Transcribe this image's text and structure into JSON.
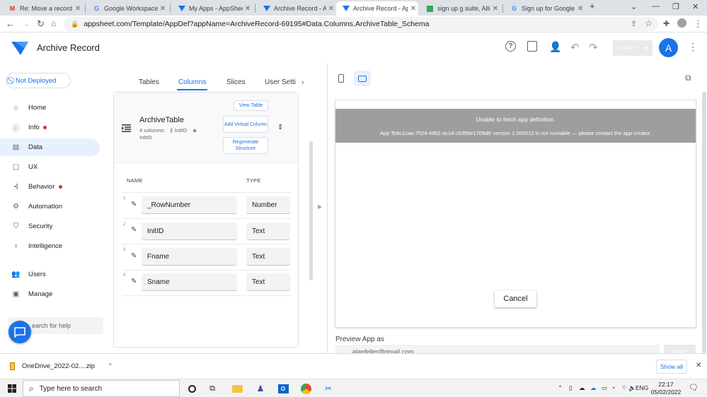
{
  "browser": {
    "tabs": [
      {
        "label": "Re: Move a record to",
        "icon": "gmail-icon"
      },
      {
        "label": "Google Workspace - (",
        "icon": "google-icon"
      },
      {
        "label": "My Apps - AppSheet",
        "icon": "appsheet-icon"
      },
      {
        "label": "Archive Record - App",
        "icon": "appsheet-icon"
      },
      {
        "label": "Archive Record - App",
        "icon": "appsheet-icon",
        "active": true
      },
      {
        "label": "sign up g suite, Allinfo",
        "icon": "sheets-icon"
      },
      {
        "label": "Sign up for Google W",
        "icon": "google-icon"
      }
    ],
    "new_tab": "+",
    "url": "appsheet.com/Template/AppDef?appName=ArchiveRecord-69195#Data.Columns.ArchiveTable_Schema"
  },
  "app": {
    "title": "Archive Record",
    "save_label": "SAVE",
    "avatar_letter": "A"
  },
  "sidebar": {
    "deploy_status": "Not Deployed",
    "items": [
      {
        "label": "Home",
        "icon": "home-icon"
      },
      {
        "label": "Info",
        "icon": "info-icon",
        "dot": true
      },
      {
        "label": "Data",
        "icon": "data-icon",
        "active": true
      },
      {
        "label": "UX",
        "icon": "ux-icon"
      },
      {
        "label": "Behavior",
        "icon": "behavior-icon",
        "dot": true
      },
      {
        "label": "Automation",
        "icon": "automation-icon"
      },
      {
        "label": "Security",
        "icon": "shield-icon"
      },
      {
        "label": "Intelligence",
        "icon": "bulb-icon"
      },
      {
        "label": "Users",
        "icon": "users-icon"
      },
      {
        "label": "Manage",
        "icon": "manage-icon"
      }
    ],
    "search_placeholder": "earch for help"
  },
  "subtabs": [
    "Tables",
    "Columns",
    "Slices",
    "User Setti"
  ],
  "table": {
    "name": "ArchiveTable",
    "meta_columns": "4 columns:",
    "meta_key": "InitID",
    "meta_label": "InitID",
    "view_table": "View Table",
    "add_virtual_column": "Add Virtual Column",
    "regenerate_structure": "Regenerate Structure",
    "col_headers": {
      "name": "NAME",
      "type": "TYPE"
    },
    "rows": [
      {
        "num": "1",
        "name": "_RowNumber",
        "type": "Number"
      },
      {
        "num": "2",
        "name": "InitID",
        "type": "Text"
      },
      {
        "num": "3",
        "name": "Fname",
        "type": "Text"
      },
      {
        "num": "4",
        "name": "Sname",
        "type": "Text"
      }
    ]
  },
  "preview": {
    "error_title": "Unable to fetch app definition.",
    "error_detail": "App 'fb9c1caa-7524-4962-ac1d-c6395e1709d8' version 1.000012 is not runnable — please contact the app creator.",
    "cancel_label": "Cancel",
    "preview_as_label": "Preview App as",
    "preview_email": "alanfeller@gmail.com",
    "apply_label": "Apply"
  },
  "download": {
    "filename": "OneDrive_2022-02....zip",
    "show_all": "Show all"
  },
  "taskbar": {
    "search_placeholder": "Type here to search",
    "lang": "ENG",
    "time": "22:17",
    "date": "05/02/2022"
  },
  "colors": {
    "accent": "#1a73e8",
    "active_nav_bg": "#e8f0fe",
    "error_bar": "#9e9e9e",
    "red_dot": "#d93025"
  }
}
